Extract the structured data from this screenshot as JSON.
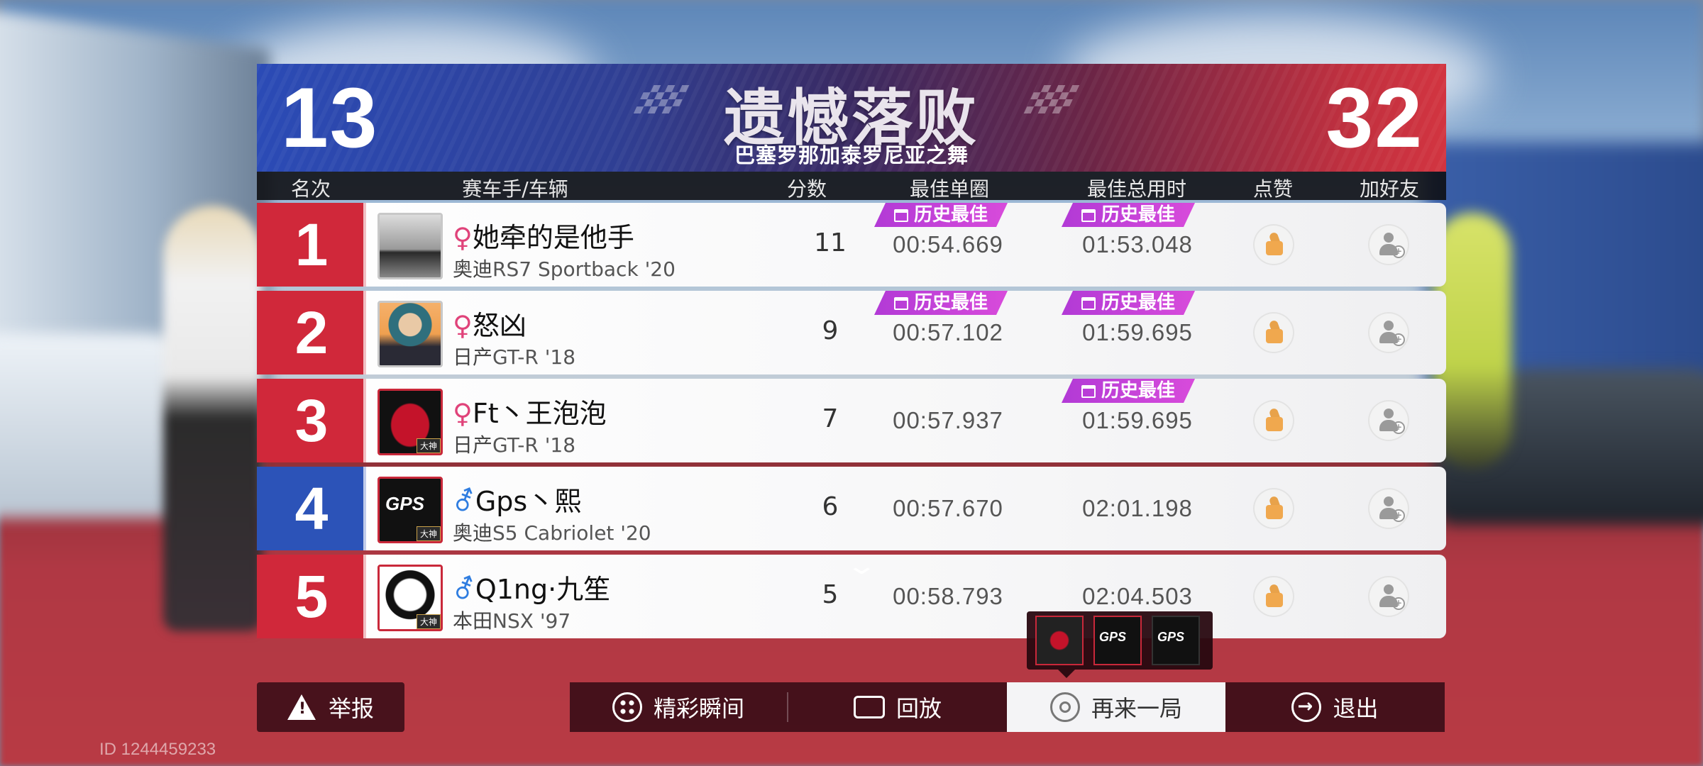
{
  "header": {
    "left_score": "13",
    "right_score": "32",
    "title": "遗憾落败",
    "track": "巴塞罗那加泰罗尼亚之舞"
  },
  "columns": {
    "rank": "名次",
    "racer": "赛车手/车辆",
    "points": "分数",
    "best_lap": "最佳单圈",
    "best_total": "最佳总用时",
    "like": "点赞",
    "add_friend": "加好友"
  },
  "history_best_label": "历史最佳",
  "rows": [
    {
      "rank": "1",
      "sex": "♀",
      "name": "她牵的是他手",
      "brand": "奥迪",
      "model": "RS7 Sportback  '20",
      "points": "11",
      "best_lap": "00:54.669",
      "best_total": "01:53.048"
    },
    {
      "rank": "2",
      "sex": "♀",
      "name": "怒凶",
      "brand": "日产",
      "model": "GT-R  '18",
      "points": "9",
      "best_lap": "00:57.102",
      "best_total": "01:59.695"
    },
    {
      "rank": "3",
      "sex": "♀",
      "name": "Ft丶王泡泡",
      "brand": "日产",
      "model": "GT-R  '18",
      "points": "7",
      "best_lap": "00:57.937",
      "best_total": "01:59.695"
    },
    {
      "rank": "4",
      "sex": "⚦",
      "name": "Gps丶熙",
      "brand": "奥迪",
      "model": "S5 Cabriolet  '20",
      "points": "6",
      "best_lap": "00:57.670",
      "best_total": "02:01.198"
    },
    {
      "rank": "5",
      "sex": "⚦",
      "name": "Q1ng·九笙",
      "brand": "本田",
      "model": "NSX  '97",
      "points": "5",
      "best_lap": "00:58.793",
      "best_total": "02:04.503"
    }
  ],
  "avatar_badge": "大神",
  "avatar_logo": "GPS",
  "buttons": {
    "report": "举报",
    "highlights": "精彩瞬间",
    "replay": "回放",
    "again": "再来一局",
    "exit": "退出"
  },
  "user_id": "ID 1244459233",
  "colors": {
    "red_team": "#d0283a",
    "blue_team": "#2c53b8",
    "history_badge": "#c43fd8"
  }
}
